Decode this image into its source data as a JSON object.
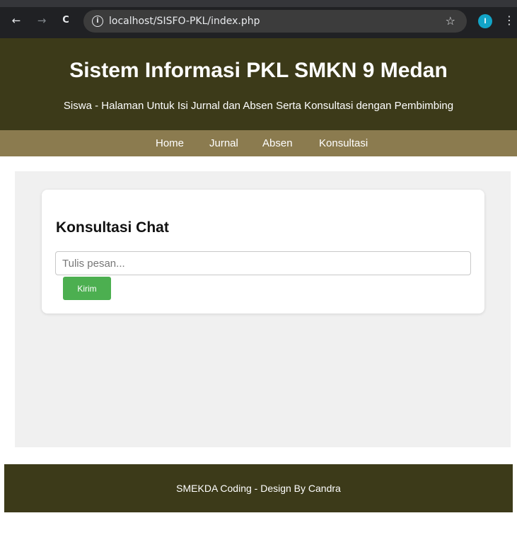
{
  "browser": {
    "url": "localhost/SISFO-PKL/index.php",
    "back_icon": "←",
    "forward_icon": "→",
    "reload_icon": "C",
    "info_icon": "i",
    "star_icon": "☆",
    "profile_initial": "I",
    "menu_icon": "⋮",
    "colors": {
      "chrome": "#202124",
      "omnibox": "#3c3c3c",
      "avatar": "#12a4c7"
    }
  },
  "header": {
    "title": "Sistem Informasi PKL SMKN 9 Medan",
    "subtitle": "Siswa - Halaman Untuk Isi Jurnal dan Absen Serta Konsultasi dengan Pembimbing"
  },
  "nav": {
    "items": [
      {
        "label": "Home"
      },
      {
        "label": "Jurnal"
      },
      {
        "label": "Absen"
      },
      {
        "label": "Konsultasi"
      }
    ]
  },
  "chat": {
    "title": "Konsultasi Chat",
    "input_placeholder": "Tulis pesan...",
    "input_value": "",
    "send_label": "Kirim"
  },
  "footer": {
    "text": "SMEKDA Coding - Design By Candra"
  },
  "colors": {
    "header_bg": "#3c3a19",
    "nav_bg": "#8b7b4f",
    "content_bg": "#f0f0f0",
    "button_bg": "#4caf50"
  }
}
